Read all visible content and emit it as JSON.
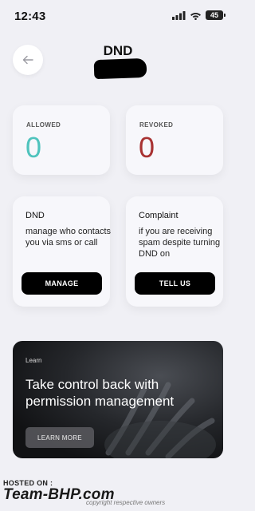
{
  "status_bar": {
    "time": "12:43",
    "battery": "45"
  },
  "header": {
    "title": "DND"
  },
  "stats": {
    "allowed": {
      "label": "ALLOWED",
      "value": "0",
      "color": "#4fc3bd"
    },
    "revoked": {
      "label": "REVOKED",
      "value": "0",
      "color": "#a83232"
    }
  },
  "dnd_card": {
    "title": "DND",
    "description": "manage who contacts you via sms or call",
    "button": "MANAGE"
  },
  "complaint_card": {
    "title": "Complaint",
    "description": "if you are receiving spam despite turning DND on",
    "button": "TELL US"
  },
  "learn_card": {
    "tag": "Learn",
    "headline": "Take control back with permission management",
    "button": "LEARN MORE"
  },
  "watermark": {
    "hosted": "HOSTED ON :",
    "logo": "Team-BHP.com",
    "owner": "copyright respective owners"
  }
}
